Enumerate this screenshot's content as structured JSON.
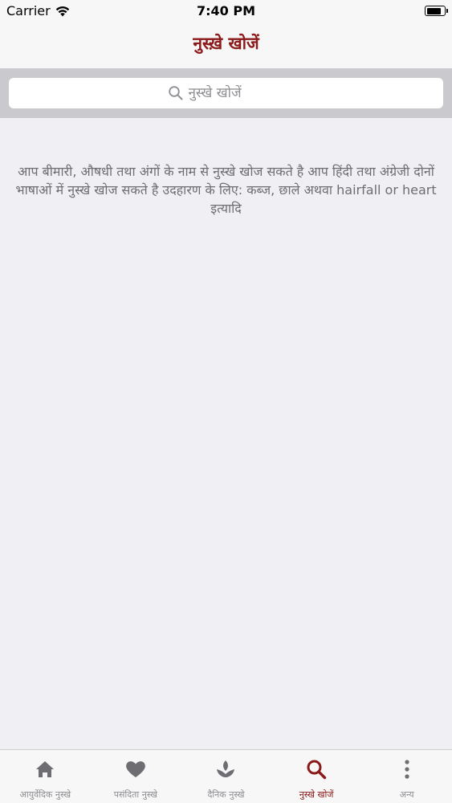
{
  "status_bar": {
    "carrier": "Carrier",
    "time": "7:40 PM",
    "battery_level": 0.85
  },
  "nav": {
    "title": "नुस्ख़े खोजें"
  },
  "search": {
    "placeholder": "नुस्खे खोजें",
    "value": ""
  },
  "hint": {
    "text": "आप बीमारी, औषधी तथा अंगों के नाम से नुस्खे खोज सकते है आप हिंदी तथा अंग्रेजी दोनों भाषाओं में नुस्खे खोज सकते है उदहारण के लिए: कब्ज, छाले अथवा hairfall or heart इत्यादि"
  },
  "tabs": [
    {
      "label": "आयुर्वेदिक नुस्खे",
      "icon": "home-icon",
      "active": false
    },
    {
      "label": "पसंदिता नुस्खे",
      "icon": "heart-icon",
      "active": false
    },
    {
      "label": "दैनिक नुस्खे",
      "icon": "lotus-icon",
      "active": false
    },
    {
      "label": "नुस्खे खोजें",
      "icon": "search-icon",
      "active": true
    },
    {
      "label": "अन्य",
      "icon": "more-vertical-icon",
      "active": false
    }
  ],
  "colors": {
    "accent": "#8b1a1a",
    "inactive": "#8e8e93",
    "background": "#efeff4",
    "search_bar_bg": "#c9c9ce"
  }
}
